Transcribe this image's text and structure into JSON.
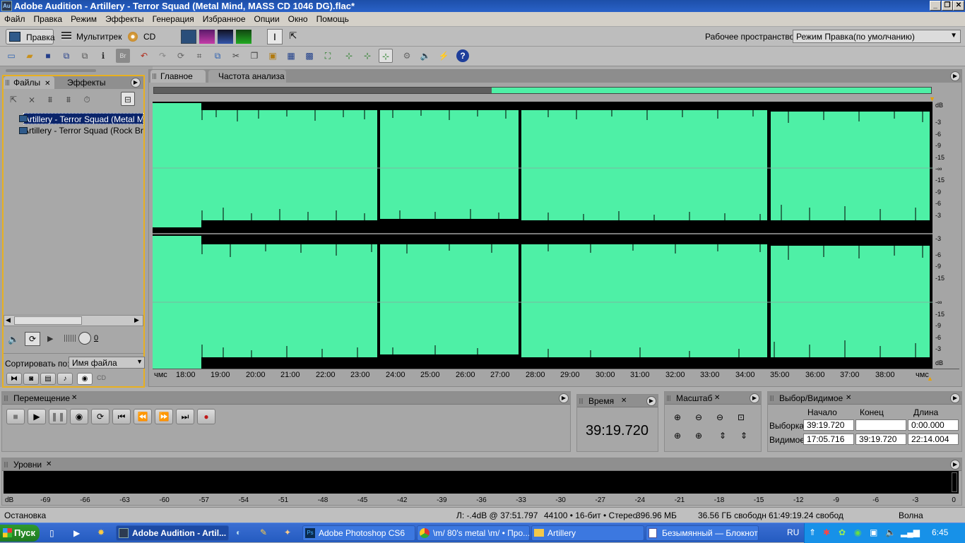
{
  "app": {
    "title": "Adobe Audition - Artillery - Terror Squad (Metal Mind, MASS CD 1046 DG).flac*",
    "logo": "Au"
  },
  "menu": [
    "Файл",
    "Правка",
    "Режим",
    "Эффекты",
    "Генерация",
    "Избранное",
    "Опции",
    "Окно",
    "Помощь"
  ],
  "modes": {
    "edit": "Правка",
    "multitrack": "Мультитрек",
    "cd": "CD"
  },
  "workspace": {
    "label": "Рабочее пространство:",
    "value": "Режим Правка(по умолчанию)"
  },
  "files_panel": {
    "tabs": [
      "Файлы",
      "Эффекты"
    ],
    "files": [
      "Artillery - Terror Squad (Metal Mind",
      "Artillery - Terror Squad (Rock Brig"
    ],
    "sort_label": "Сортировать по:",
    "sort_value": "Имя файла",
    "volume_value": "0"
  },
  "editor": {
    "tabs": [
      "Главное",
      "Частота анализа"
    ],
    "db_labels": [
      "dB",
      "-3",
      "-6",
      "-9",
      "-15",
      "-∞",
      "-15",
      "-9",
      "-6",
      "-3",
      "",
      "-3",
      "-6",
      "-9",
      "-15",
      "-∞",
      "-15",
      "-9",
      "-6",
      "-3",
      "dB"
    ],
    "time_labels": [
      "чмс",
      "18:00",
      "19:00",
      "20:00",
      "21:00",
      "22:00",
      "23:00",
      "24:00",
      "25:00",
      "26:00",
      "27:00",
      "28:00",
      "29:00",
      "30:00",
      "31:00",
      "32:00",
      "33:00",
      "34:00",
      "35:00",
      "36:00",
      "37:00",
      "38:00",
      "чмс"
    ]
  },
  "transport": {
    "title": "Перемещение"
  },
  "time_panel": {
    "title": "Время",
    "value": "39:19.720"
  },
  "zoom_panel": {
    "title": "Масштаб"
  },
  "selection_panel": {
    "title": "Выбор/Видимое",
    "cols": [
      "Начало",
      "Конец",
      "Длина"
    ],
    "rows": [
      {
        "label": "Выборка",
        "start": "39:19.720",
        "end": "",
        "length": "0:00.000"
      },
      {
        "label": "Видимое",
        "start": "17:05.716",
        "end": "39:19.720",
        "length": "22:14.004"
      }
    ]
  },
  "levels": {
    "title": "Уровни",
    "labels": [
      "dB",
      "-69",
      "-66",
      "-63",
      "-60",
      "-57",
      "-54",
      "-51",
      "-48",
      "-45",
      "-42",
      "-39",
      "-36",
      "-33",
      "-30",
      "-27",
      "-24",
      "-21",
      "-18",
      "-15",
      "-12",
      "-9",
      "-6",
      "-3",
      "0"
    ]
  },
  "statusbar": {
    "state": "Остановка",
    "cursor": "Л: -.4dB @  37:51.797",
    "format": "44100 • 16-бит • Стерео",
    "size": "396.96 МБ",
    "free": "36.56 ГБ свободн",
    "free_time": "61:49:19.24 свобод",
    "view": "Волна"
  },
  "taskbar": {
    "start": "Пуск",
    "tasks": [
      "Adobe Audition - Artil...",
      "Adobe Photoshop CS6",
      "\\m/ 80's metal \\m/ • Про...",
      "Artillery",
      "Безымянный — Блокнот"
    ],
    "lang": "RU",
    "clock": "6:45"
  },
  "colors": {
    "wave": "#4ef0a6",
    "wave_bg": "#000000",
    "title_bar": "#1d4fa9",
    "taskbar": "#245bc0"
  }
}
